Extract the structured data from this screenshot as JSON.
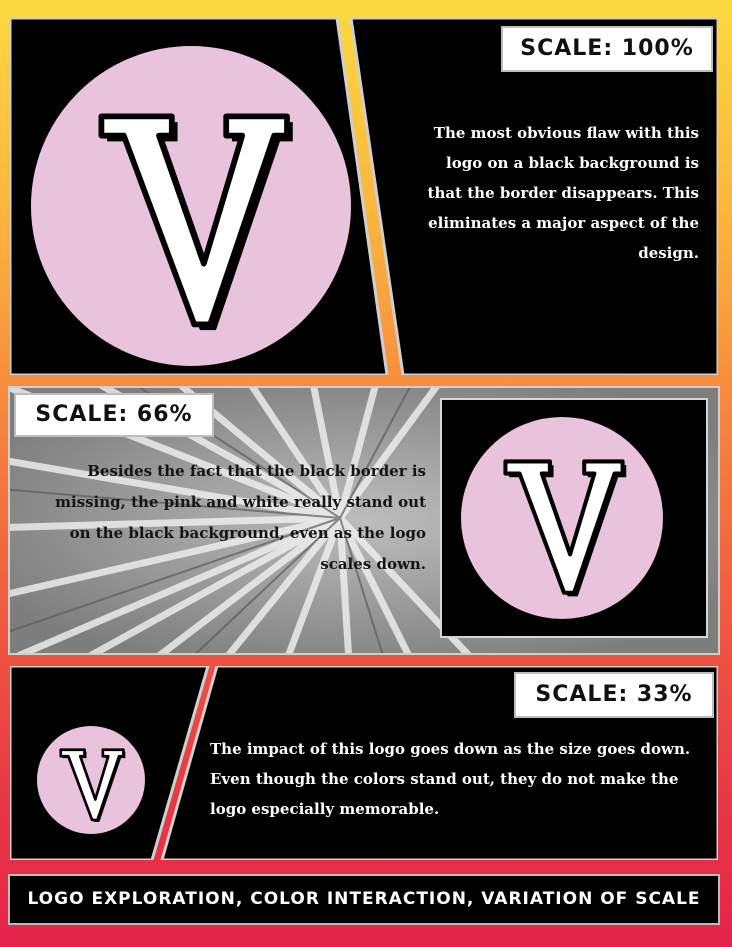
{
  "panels": [
    {
      "scale_label": "SCALE: 100%",
      "text": "The most obvious flaw with this logo on a black background is that the border disappears. This eliminates a major aspect of the design.",
      "logo_letter": "V"
    },
    {
      "scale_label": "SCALE: 66%",
      "text": "Besides the fact that the black border is missing, the pink and white really stand out on the black background, even as the logo scales down.",
      "logo_letter": "V"
    },
    {
      "scale_label": "SCALE: 33%",
      "text": "The impact of this logo goes down as the size goes down. Even though the colors stand out, they do not make the logo especially memorable.",
      "logo_letter": "V"
    }
  ],
  "footer": "LOGO EXPLORATION, COLOR INTERACTION, VARIATION OF SCALE",
  "colors": {
    "logo_pink": "#e9c2dc",
    "panel_black": "#000000",
    "gradient_top": "#fcd83f",
    "gradient_bottom": "#e5224a"
  }
}
